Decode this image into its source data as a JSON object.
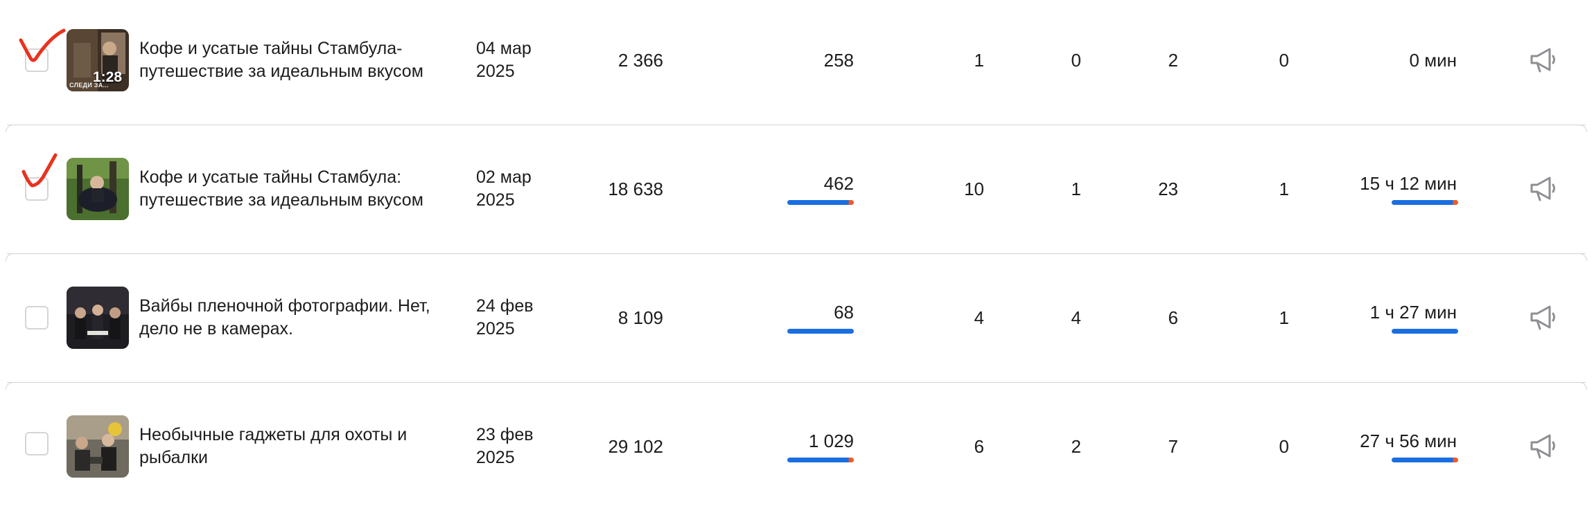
{
  "rows": [
    {
      "title_line1": "Кофе и усатые тайны Стамбула-",
      "title_line2": "путешествие за идеальным вкусом",
      "date_line1": "04 мар",
      "date_line2": "2025",
      "views": "2 366",
      "reach": "258",
      "stat1": "1",
      "stat2": "0",
      "stat3": "2",
      "stat4": "0",
      "watch_time": "0 мин",
      "checked": true,
      "thumb_duration": "1:28",
      "thumb_caption": "СЛЕДИ ЗА...",
      "thumb_icon": "video-thumbnail",
      "show_bars": false
    },
    {
      "title_line1": "Кофе и усатые тайны Стамбула:",
      "title_line2": "путешествие за идеальным вкусом",
      "date_line1": "02 мар",
      "date_line2": "2025",
      "views": "18 638",
      "reach": "462",
      "stat1": "10",
      "stat2": "1",
      "stat3": "23",
      "stat4": "1",
      "watch_time": "15 ч 12 мин",
      "checked": true,
      "thumb_icon": "video-thumbnail",
      "show_bars": true
    },
    {
      "title_line1": "Вайбы пленочной фотографии. Нет,",
      "title_line2": "дело не в камерах.",
      "date_line1": "24 фев",
      "date_line2": "2025",
      "views": "8 109",
      "reach": "68",
      "stat1": "4",
      "stat2": "4",
      "stat3": "6",
      "stat4": "1",
      "watch_time": "1 ч 27 мин",
      "checked": false,
      "thumb_icon": "video-thumbnail",
      "show_bars": true
    },
    {
      "title_line1": "Необычные гаджеты для охоты и",
      "title_line2": "рыбалки",
      "date_line1": "23 фев",
      "date_line2": "2025",
      "views": "29 102",
      "reach": "1 029",
      "stat1": "6",
      "stat2": "2",
      "stat3": "7",
      "stat4": "0",
      "watch_time": "27 ч 56 мин",
      "checked": false,
      "thumb_icon": "video-thumbnail",
      "show_bars": true
    }
  ],
  "colors": {
    "accent_blue": "#1a6ee0",
    "accent_orange": "#f05a28",
    "check_red": "#e8321e",
    "separator": "#d3d3d6"
  },
  "icons": {
    "promote": "megaphone-icon",
    "check": "red-checkmark-icon"
  }
}
